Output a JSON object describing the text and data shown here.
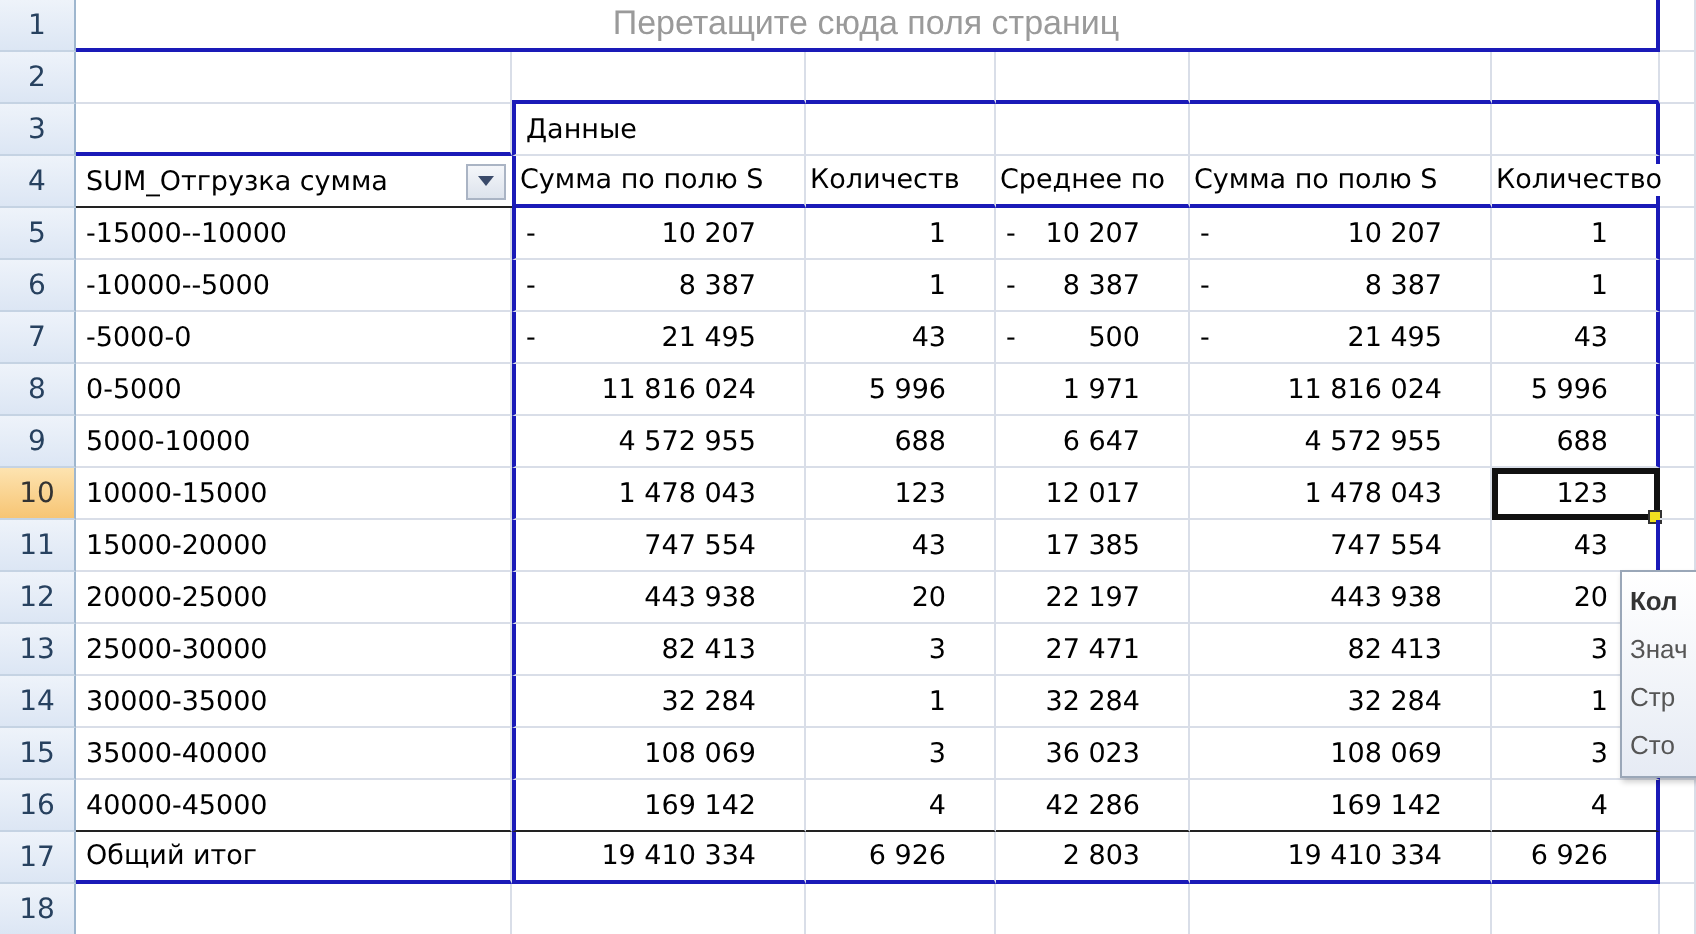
{
  "row_headers": [
    {
      "label": "1",
      "selected": false
    },
    {
      "label": "2",
      "selected": false
    },
    {
      "label": "3",
      "selected": false
    },
    {
      "label": "4",
      "selected": false
    },
    {
      "label": "5",
      "selected": false
    },
    {
      "label": "6",
      "selected": false
    },
    {
      "label": "7",
      "selected": false
    },
    {
      "label": "8",
      "selected": false
    },
    {
      "label": "9",
      "selected": false
    },
    {
      "label": "10",
      "selected": true
    },
    {
      "label": "11",
      "selected": false
    },
    {
      "label": "12",
      "selected": false
    },
    {
      "label": "13",
      "selected": false
    },
    {
      "label": "14",
      "selected": false
    },
    {
      "label": "15",
      "selected": false
    },
    {
      "label": "16",
      "selected": false
    },
    {
      "label": "17",
      "selected": false
    },
    {
      "label": "18",
      "selected": false
    }
  ],
  "page_field_placeholder": "Перетащите сюда поля страниц",
  "data_label": "Данные",
  "row_field": {
    "label": "SUM_Отгрузка сумма"
  },
  "columns": [
    "Сумма по полю S",
    "Количеств",
    "Среднее по",
    "Сумма по полю S",
    "Количество"
  ],
  "rows": [
    {
      "label": "-15000--10000",
      "cells": [
        {
          "sign": "-",
          "value": "10 207",
          "selected": false
        },
        {
          "value": "1",
          "selected": false
        },
        {
          "sign": "-",
          "value": "10 207",
          "selected": false
        },
        {
          "sign": "-",
          "value": "10 207",
          "selected": false
        },
        {
          "value": "1",
          "selected": false
        }
      ]
    },
    {
      "label": "-10000--5000",
      "cells": [
        {
          "sign": "-",
          "value": "8 387",
          "selected": false
        },
        {
          "value": "1",
          "selected": false
        },
        {
          "sign": "-",
          "value": "8 387",
          "selected": false
        },
        {
          "sign": "-",
          "value": "8 387",
          "selected": false
        },
        {
          "value": "1",
          "selected": false
        }
      ]
    },
    {
      "label": "-5000-0",
      "cells": [
        {
          "sign": "-",
          "value": "21 495",
          "selected": false
        },
        {
          "value": "43",
          "selected": false
        },
        {
          "sign": "-",
          "value": "500",
          "selected": false
        },
        {
          "sign": "-",
          "value": "21 495",
          "selected": false
        },
        {
          "value": "43",
          "selected": false
        }
      ]
    },
    {
      "label": "0-5000",
      "cells": [
        {
          "value": "11 816 024",
          "selected": false
        },
        {
          "value": "5 996",
          "selected": false
        },
        {
          "value": "1 971",
          "selected": false
        },
        {
          "value": "11 816 024",
          "selected": false
        },
        {
          "value": "5 996",
          "selected": false
        }
      ]
    },
    {
      "label": "5000-10000",
      "cells": [
        {
          "value": "4 572 955",
          "selected": false
        },
        {
          "value": "688",
          "selected": false
        },
        {
          "value": "6 647",
          "selected": false
        },
        {
          "value": "4 572 955",
          "selected": false
        },
        {
          "value": "688",
          "selected": false
        }
      ]
    },
    {
      "label": "10000-15000",
      "cells": [
        {
          "value": "1 478 043",
          "selected": false
        },
        {
          "value": "123",
          "selected": false
        },
        {
          "value": "12 017",
          "selected": false
        },
        {
          "value": "1 478 043",
          "selected": false
        },
        {
          "value": "123",
          "selected": true
        }
      ]
    },
    {
      "label": "15000-20000",
      "cells": [
        {
          "value": "747 554",
          "selected": false
        },
        {
          "value": "43",
          "selected": false
        },
        {
          "value": "17 385",
          "selected": false
        },
        {
          "value": "747 554",
          "selected": false
        },
        {
          "value": "43",
          "selected": false
        }
      ]
    },
    {
      "label": "20000-25000",
      "cells": [
        {
          "value": "443 938",
          "selected": false
        },
        {
          "value": "20",
          "selected": false
        },
        {
          "value": "22 197",
          "selected": false
        },
        {
          "value": "443 938",
          "selected": false
        },
        {
          "value": "20",
          "selected": false
        }
      ]
    },
    {
      "label": "25000-30000",
      "cells": [
        {
          "value": "82 413",
          "selected": false
        },
        {
          "value": "3",
          "selected": false
        },
        {
          "value": "27 471",
          "selected": false
        },
        {
          "value": "82 413",
          "selected": false
        },
        {
          "value": "3",
          "selected": false
        }
      ]
    },
    {
      "label": "30000-35000",
      "cells": [
        {
          "value": "32 284",
          "selected": false
        },
        {
          "value": "1",
          "selected": false
        },
        {
          "value": "32 284",
          "selected": false
        },
        {
          "value": "32 284",
          "selected": false
        },
        {
          "value": "1",
          "selected": false
        }
      ]
    },
    {
      "label": "35000-40000",
      "cells": [
        {
          "value": "108 069",
          "selected": false
        },
        {
          "value": "3",
          "selected": false
        },
        {
          "value": "36 023",
          "selected": false
        },
        {
          "value": "108 069",
          "selected": false
        },
        {
          "value": "3",
          "selected": false
        }
      ]
    },
    {
      "label": "40000-45000",
      "cells": [
        {
          "value": "169 142",
          "selected": false
        },
        {
          "value": "4",
          "selected": false
        },
        {
          "value": "42 286",
          "selected": false
        },
        {
          "value": "169 142",
          "selected": false
        },
        {
          "value": "4",
          "selected": false
        }
      ]
    },
    {
      "label": "Общий итог",
      "cells": [
        {
          "value": "19 410 334",
          "selected": false
        },
        {
          "value": "6 926",
          "selected": false
        },
        {
          "value": "2 803",
          "selected": false
        },
        {
          "value": "19 410 334",
          "selected": false
        },
        {
          "value": "6 926",
          "selected": false
        }
      ]
    }
  ],
  "tooltip": {
    "title": "Кол",
    "lines": [
      "Знач",
      "Стр",
      "Сто"
    ]
  }
}
